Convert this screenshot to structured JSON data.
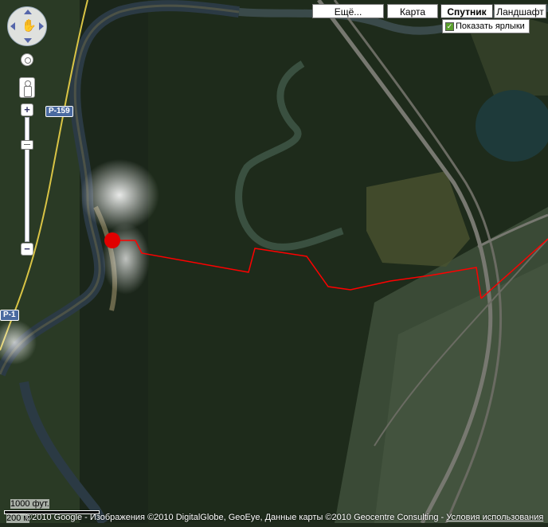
{
  "map_type_controls": {
    "more": "Ещё...",
    "map": "Карта",
    "satellite": "Спутник",
    "terrain": "Ландшафт",
    "active": "Спутник"
  },
  "labels_checkbox": {
    "label": "Показать ярлыки",
    "checked": true
  },
  "nav": {
    "pan_icon": "hand-icon",
    "zoom_in": "+",
    "zoom_out": "−",
    "zoom_level_fraction": 0.2
  },
  "road_shields": {
    "p159": "Р-159",
    "p1": "Р-1"
  },
  "scale": {
    "upper": "1000 фут.",
    "lower": "200 м"
  },
  "copyright": {
    "text": "©2010 Google - Изображения ©2010 DigitalGlobe, GeoEye, Данные карты ©2010 Geocentre Consulting - ",
    "terms": "Условия использования"
  },
  "colors": {
    "route": "#ff0000",
    "marker": "#e00000",
    "road_shield": "#4a6aa0"
  }
}
